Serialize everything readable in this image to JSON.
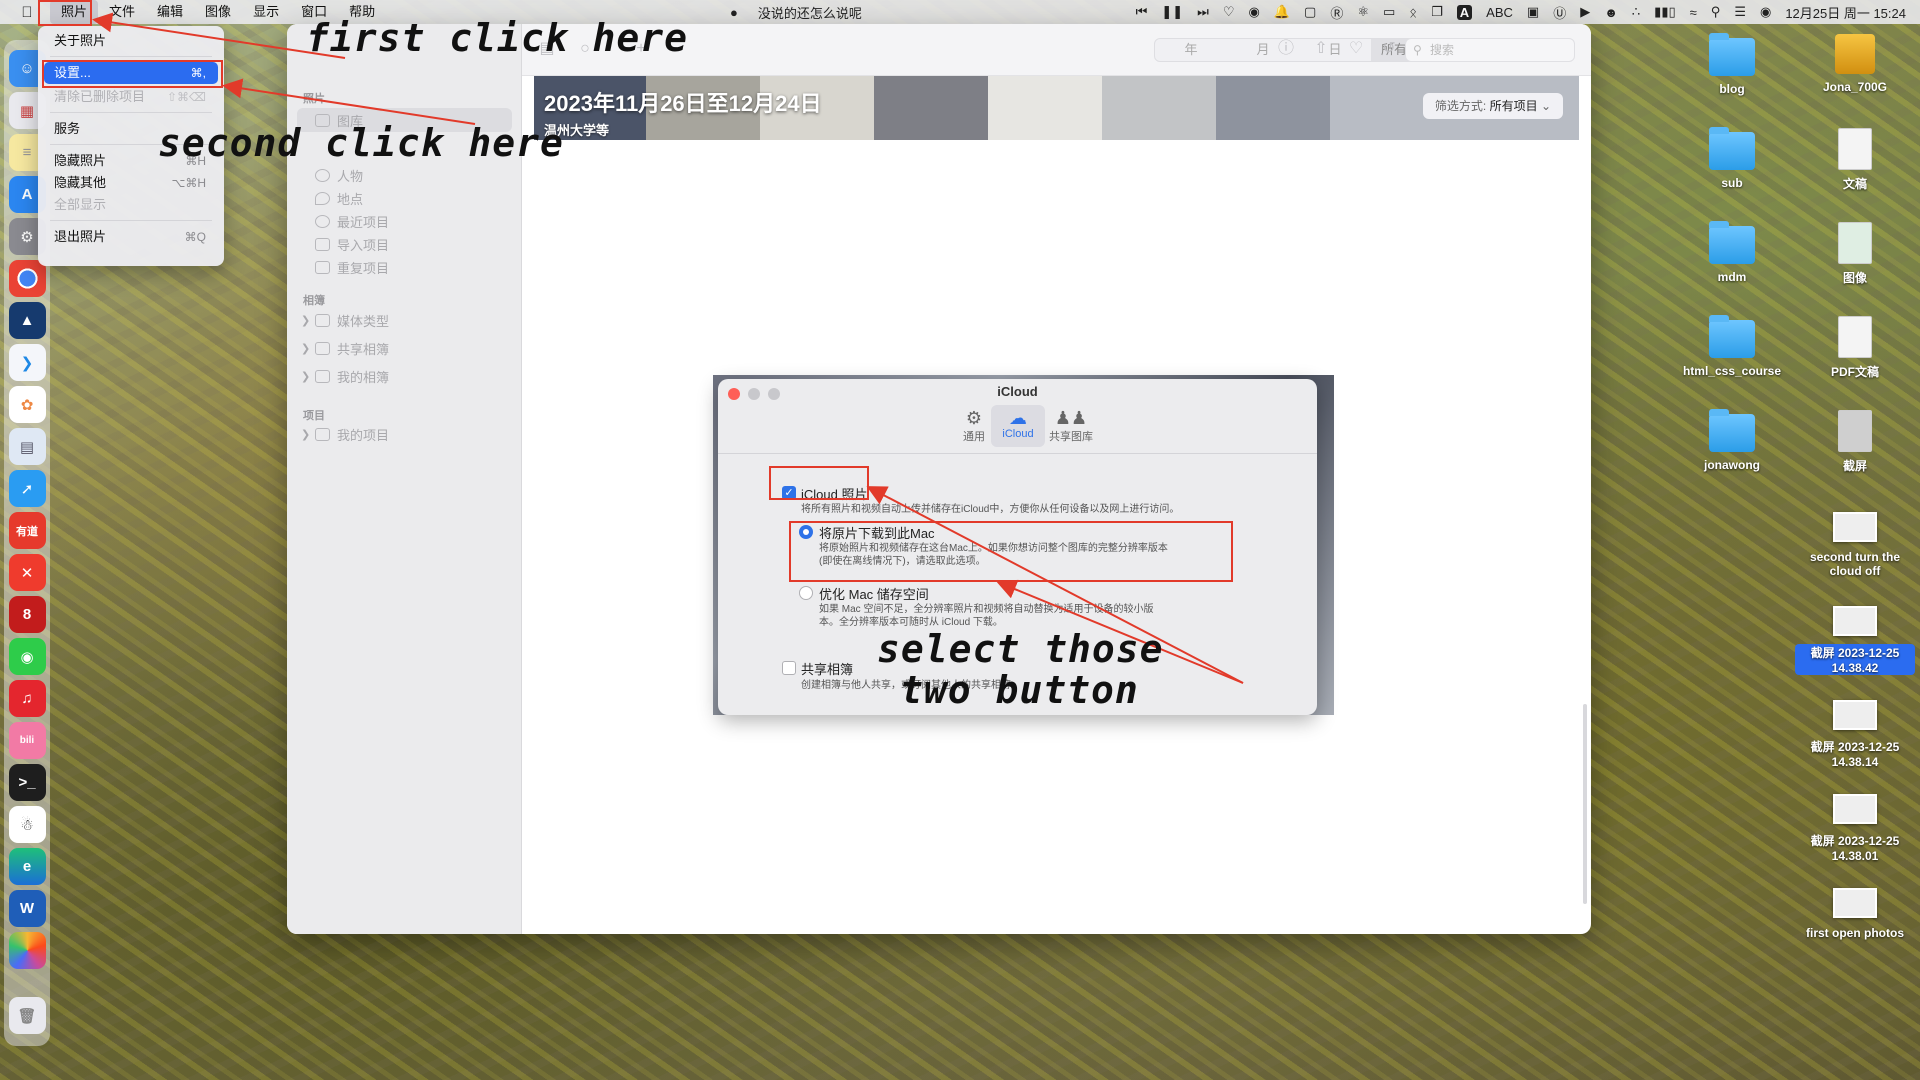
{
  "menubar": {
    "app_menu": "照片",
    "menus": [
      "文件",
      "编辑",
      "图像",
      "显示",
      "窗口",
      "帮助"
    ],
    "now_playing": "没说的还怎么说呢",
    "input_method": "ABC",
    "datetime": "12月25日 周一  15:24"
  },
  "app_menu_dropdown": {
    "items": [
      {
        "label": "关于照片",
        "shortcut": ""
      },
      {
        "label": "设置...",
        "shortcut": "⌘,"
      },
      {
        "label": "清除已删除项目",
        "shortcut": "⇧⌘⌫"
      },
      {
        "label": "服务",
        "shortcut": ""
      },
      {
        "label": "隐藏照片",
        "shortcut": "⌘H"
      },
      {
        "label": "隐藏其他",
        "shortcut": "⌥⌘H"
      },
      {
        "label": "全部显示",
        "shortcut": ""
      },
      {
        "label": "退出照片",
        "shortcut": "⌘Q"
      }
    ]
  },
  "sidebar": {
    "section_photos": "照片",
    "items": [
      "图库",
      "人物",
      "地点",
      "最近项目",
      "导入项目",
      "重复项目"
    ],
    "section_albums": "相簿",
    "album_items": [
      "媒体类型",
      "共享相簿",
      "我的相簿"
    ],
    "section_projects": "项目",
    "project_items": [
      "我的项目"
    ]
  },
  "toolbar": {
    "segments": [
      "年",
      "月",
      "日",
      "所有照片"
    ],
    "search_placeholder": "搜索"
  },
  "banner": {
    "title": "2023年11月26日至12月24日",
    "subtitle": "温州大学等",
    "filter_label": "筛选方式:",
    "filter_value": "所有项目"
  },
  "settings": {
    "window_title": "iCloud",
    "tabs": [
      "通用",
      "iCloud",
      "共享图库"
    ],
    "icloud_photos_label": "iCloud 照片",
    "icloud_photos_desc": "将所有照片和视频自动上传并储存在iCloud中，方便你从任何设备以及网上进行访问。",
    "download_label": "将原片下载到此Mac",
    "download_desc_1": "将原始照片和视频储存在这台Mac上。如果你想访问整个图库的完整分辨率版本",
    "download_desc_2": "(即使在离线情况下)，请选取此选项。",
    "optimize_label": "优化 Mac 储存空间",
    "optimize_desc_1": "如果 Mac 空间不足，全分辨率照片和视频将自动替换为适用于设备的较小版",
    "optimize_desc_2": "本。全分辨率版本可随时从 iCloud 下载。",
    "shared_albums_label": "共享相簿",
    "shared_albums_desc": "创建相簿与他人共享，或订阅其他人的共享相簿。"
  },
  "desktop": {
    "items": [
      {
        "label": "blog",
        "kind": "folder"
      },
      {
        "label": "Jona_700G",
        "kind": "drive"
      },
      {
        "label": "sub",
        "kind": "folder"
      },
      {
        "label": "文稿",
        "kind": "doc"
      },
      {
        "label": "mdm",
        "kind": "folder"
      },
      {
        "label": "图像",
        "kind": "doc"
      },
      {
        "label": "html_css_course",
        "kind": "folder"
      },
      {
        "label": "PDF文稿",
        "kind": "doc"
      },
      {
        "label": "jonawong",
        "kind": "folder"
      },
      {
        "label": "截屏",
        "kind": "doc"
      },
      {
        "label": "second turn the cloud off",
        "kind": "shot"
      },
      {
        "label": "截屏 2023-12-25 14.38.42",
        "kind": "shot"
      },
      {
        "label": "截屏 2023-12-25 14.38.14",
        "kind": "shot"
      },
      {
        "label": "截屏 2023-12-25 14.38.01",
        "kind": "shot"
      },
      {
        "label": "first open photos",
        "kind": "shot"
      }
    ]
  },
  "annotations": {
    "first": "first click here",
    "second": "second click here",
    "select_1": "select those",
    "select_2": "two button",
    "color": "#e23a2a"
  }
}
